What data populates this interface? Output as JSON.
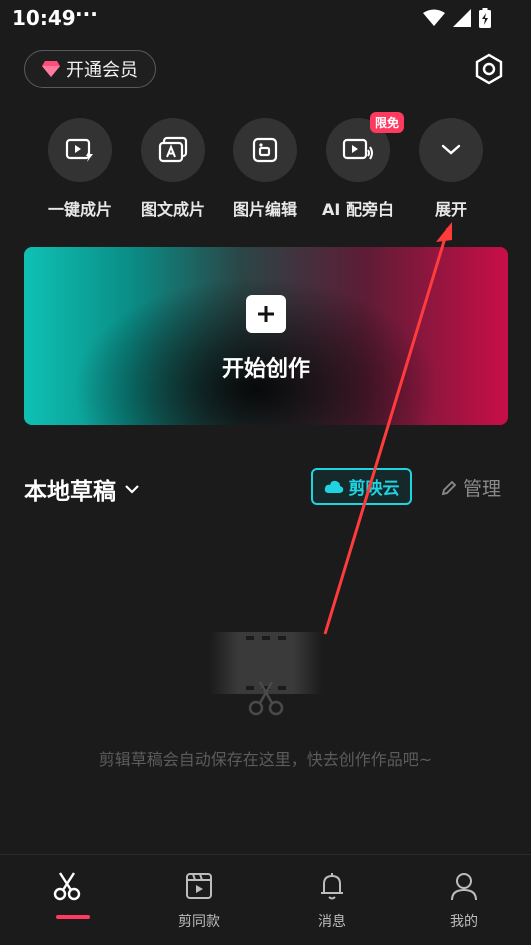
{
  "status_bar": {
    "time": "10:49",
    "dots": "···"
  },
  "header": {
    "vip_label": "开通会员"
  },
  "tools": [
    {
      "label": "一键成片",
      "icon": "video-flash-icon"
    },
    {
      "label": "图文成片",
      "icon": "image-text-icon"
    },
    {
      "label": "图片编辑",
      "icon": "image-edit-icon"
    },
    {
      "label": "AI 配旁白",
      "icon": "voice-video-icon",
      "badge": "限免"
    },
    {
      "label": "展开",
      "icon": "chevron-down-icon"
    }
  ],
  "create_card": {
    "label": "开始创作"
  },
  "drafts": {
    "title": "本地草稿",
    "cloud_label": "剪映云",
    "manage_label": "管理",
    "empty_text": "剪辑草稿会自动保存在这里，快去创作作品吧~"
  },
  "tabbar": [
    {
      "label": "",
      "icon": "scissors-icon",
      "active": true
    },
    {
      "label": "剪同款",
      "icon": "template-clapper-icon"
    },
    {
      "label": "消息",
      "icon": "bell-icon"
    },
    {
      "label": "我的",
      "icon": "user-icon"
    }
  ],
  "colors": {
    "accent_cyan": "#1fd3e2",
    "accent_red": "#ff3a60",
    "background": "#1b1b1b"
  }
}
